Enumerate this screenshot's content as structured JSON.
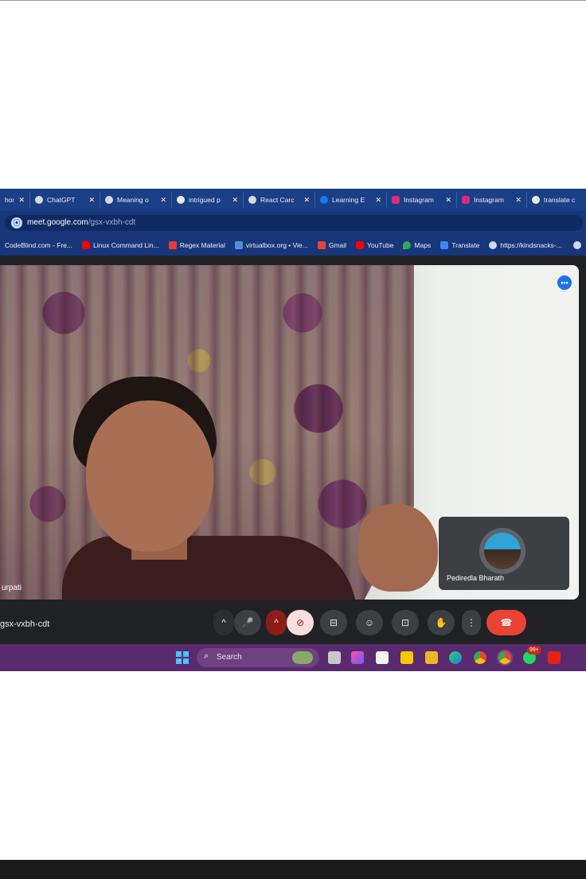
{
  "browser": {
    "tabs": [
      {
        "label": "hou",
        "favicon": "partial-icon",
        "color": "#8ea3cc"
      },
      {
        "label": "ChatGPT",
        "favicon": "chatgpt-icon",
        "color": "#d9d9d9"
      },
      {
        "label": "Meaning o",
        "favicon": "dot-icon",
        "color": "#d9d9d9"
      },
      {
        "label": "intrigued p",
        "favicon": "google-icon",
        "color": "#e8eaed"
      },
      {
        "label": "React Carc",
        "favicon": "dot-icon",
        "color": "#d9d9d9"
      },
      {
        "label": "Learning E",
        "favicon": "facebook-icon",
        "color": "#1877f2"
      },
      {
        "label": "Instagram",
        "favicon": "instagram-icon",
        "color": "#dd2a7b"
      },
      {
        "label": "Instagram",
        "favicon": "instagram-icon",
        "color": "#dd2a7b"
      },
      {
        "label": "translate c",
        "favicon": "google-icon",
        "color": "#e8eaed"
      }
    ],
    "close_glyph": "✕",
    "url_host": "meet.google.com",
    "url_path": "/gsx-vxbh-cdt",
    "bookmarks": [
      {
        "label": "CodeBlind.com - Fre...",
        "icon": "generic-site-icon",
        "color": "#18367a"
      },
      {
        "label": "Linux Command Lin...",
        "icon": "youtube-icon",
        "color": "#ff0000"
      },
      {
        "label": "Regex Material",
        "icon": "regex-icon",
        "color": "#e53935"
      },
      {
        "label": "virtualbox.org • Vie...",
        "icon": "virtualbox-icon",
        "color": "#4a90d9"
      },
      {
        "label": "Gmail",
        "icon": "gmail-icon",
        "color": "#ea4335"
      },
      {
        "label": "YouTube",
        "icon": "youtube-icon",
        "color": "#ff0000"
      },
      {
        "label": "Maps",
        "icon": "maps-icon",
        "color": "#34a853"
      },
      {
        "label": "Translate",
        "icon": "translate-icon",
        "color": "#4285f4"
      },
      {
        "label": "https://kindsnacks-...",
        "icon": "globe-icon",
        "color": "#cfd8ea"
      }
    ]
  },
  "meet": {
    "main_participant_name": "urpati",
    "tile_participant_name": "Pediredla Bharath",
    "meeting_code": "gsx-vxbh-cdt",
    "controls": {
      "chevron_up": "^",
      "mic_icon": "🎤",
      "camera_off_icon": "⊘",
      "captions_icon": "⊟",
      "emoji_icon": "☺",
      "present_icon": "⊡",
      "raise_hand_icon": "✋",
      "more_icon": "⋮",
      "end_call_icon": "☎"
    }
  },
  "taskbar": {
    "search_placeholder": "Search",
    "notification_badge": "99+",
    "accent_start": "#4cc2ff"
  }
}
